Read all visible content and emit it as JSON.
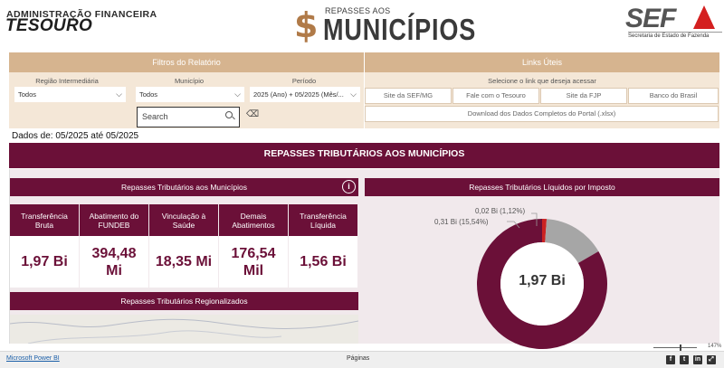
{
  "header": {
    "org_line1": "ADMINISTRAÇÃO FINANCEIRA",
    "org_line2": "TESOURO",
    "logo_small": "REPASSES AOS",
    "logo_big": "MUNICÍPIOS",
    "logo_symbol": "$",
    "sef_logo": "SEF",
    "sef_subtitle": "Secretaria de Estado de Fazenda"
  },
  "filters": {
    "title": "Filtros do Relatório",
    "regiao_label": "Região Intermediária",
    "regiao_value": "Todos",
    "municipio_label": "Município",
    "municipio_value": "Todos",
    "periodo_label": "Período",
    "periodo_value": "2025 (Ano) + 05/2025 (Mês/...",
    "search_placeholder": "Search"
  },
  "links": {
    "title": "Links Úteis",
    "subtitle": "Selecione o link que deseja acessar",
    "buttons": [
      "Site da SEF/MG",
      "Fale com o Tesouro",
      "Site da FJP",
      "Banco do Brasil"
    ],
    "download": "Download dos Dados Completos do Portal (.xlsx)"
  },
  "dados_de": "Dados de: 05/2025 até 05/2025",
  "report": {
    "title": "REPASSES TRIBUTÁRIOS AOS MUNICÍPIOS",
    "section_left": "Repasses Tributários aos Municípios",
    "section_right": "Repasses Tributários Líquidos por Imposto",
    "section_regional": "Repasses Tributários Regionalizados",
    "cards": [
      {
        "label": "Transferência Bruta",
        "value": "1,97 Bi"
      },
      {
        "label": "Abatimento do FUNDEB",
        "value": "394,48 Mi"
      },
      {
        "label": "Vinculação à Saúde",
        "value": "18,35 Mi"
      },
      {
        "label": "Demais Abatimentos",
        "value": "176,54 Mil"
      },
      {
        "label": "Transferência Líquida",
        "value": "1,56 Bi"
      }
    ]
  },
  "chart_data": {
    "type": "pie",
    "center_label": "1,97 Bi",
    "slices": [
      {
        "label": "0,02 Bi (1,12%)",
        "value": 1.12,
        "color": "#cc2222"
      },
      {
        "label": "0,31 Bi (15,54%)",
        "value": 15.54,
        "color": "#a6a6a6"
      },
      {
        "label": "",
        "value": 83.34,
        "color": "#6b1038"
      }
    ]
  },
  "footer": {
    "powerbi": "Microsoft Power BI",
    "pages": "Páginas",
    "zoom": "147%"
  },
  "colors": {
    "primary": "#6b1038",
    "panel": "#f4e7d7",
    "panel_head": "#d6b48f"
  }
}
